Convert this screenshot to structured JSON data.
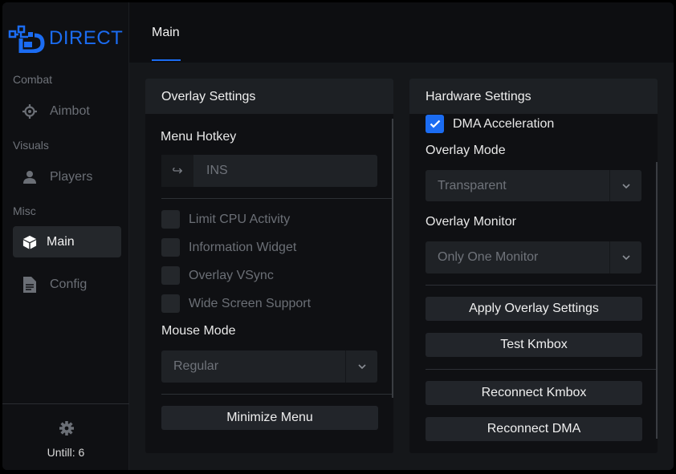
{
  "app": {
    "brand": "DIRECT",
    "accent": "#1b6cf2"
  },
  "sidebar": {
    "sections": [
      {
        "label": "Combat",
        "items": [
          {
            "label": "Aimbot",
            "icon": "crosshair-icon"
          }
        ]
      },
      {
        "label": "Visuals",
        "items": [
          {
            "label": "Players",
            "icon": "person-icon"
          }
        ]
      },
      {
        "label": "Misc",
        "items": [
          {
            "label": "Main",
            "icon": "cube-icon",
            "active": true
          },
          {
            "label": "Config",
            "icon": "document-icon"
          }
        ]
      }
    ],
    "footer": {
      "text": "Untill: 6",
      "icon": "gear-icon"
    }
  },
  "topbar": {
    "tabs": [
      {
        "label": "Main",
        "active": true
      }
    ]
  },
  "overlay_settings": {
    "title": "Overlay Settings",
    "menu_hotkey_label": "Menu Hotkey",
    "hotkey_icon": "↪",
    "hotkey_value": "INS",
    "checkboxes": [
      {
        "label": "Limit CPU Activity",
        "checked": false
      },
      {
        "label": "Information Widget",
        "checked": false
      },
      {
        "label": "Overlay VSync",
        "checked": false
      },
      {
        "label": "Wide Screen Support",
        "checked": false
      }
    ],
    "mouse_mode_label": "Mouse Mode",
    "mouse_mode_value": "Regular",
    "minimize_button": "Minimize Menu"
  },
  "hardware_settings": {
    "title": "Hardware Settings",
    "dma_acceleration": {
      "label": "DMA Acceleration",
      "checked": true
    },
    "overlay_mode_label": "Overlay Mode",
    "overlay_mode_value": "Transparent",
    "overlay_monitor_label": "Overlay Monitor",
    "overlay_monitor_value": "Only One Monitor",
    "buttons": {
      "apply_overlay": "Apply Overlay Settings",
      "test_kmbox": "Test Kmbox",
      "reconnect_kmbox": "Reconnect Kmbox",
      "reconnect_dma": "Reconnect DMA"
    }
  }
}
